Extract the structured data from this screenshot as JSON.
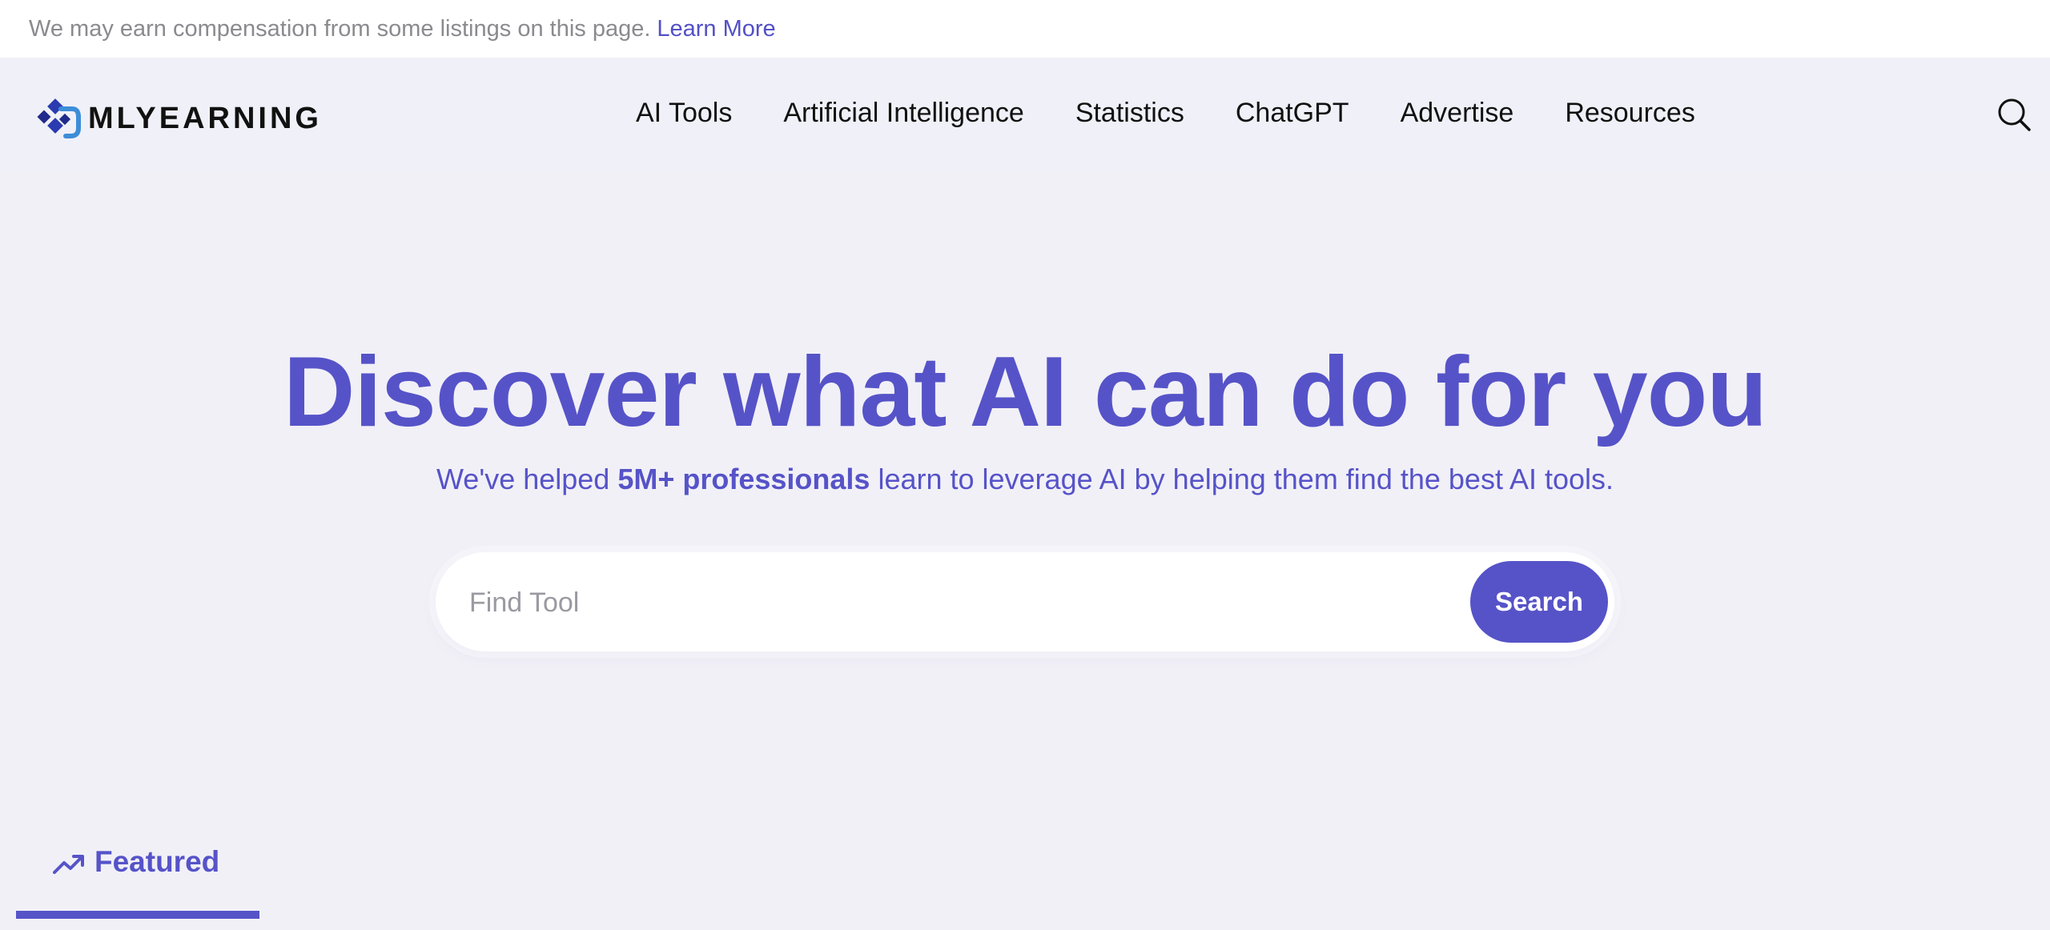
{
  "disclosure": {
    "text": "We may earn compensation from some listings on this page.",
    "link": "Learn More"
  },
  "header": {
    "logo_text": "MLYEARNING",
    "nav": [
      {
        "label": "AI Tools"
      },
      {
        "label": "Artificial Intelligence"
      },
      {
        "label": "Statistics"
      },
      {
        "label": "ChatGPT"
      },
      {
        "label": "Advertise"
      },
      {
        "label": "Resources"
      }
    ],
    "search_icon": "search-icon"
  },
  "hero": {
    "title": "Discover what AI can do for you",
    "subtitle_prefix": "We've helped ",
    "subtitle_bold": "5M+ professionals",
    "subtitle_suffix": " learn to leverage AI by helping them find the best AI tools."
  },
  "search": {
    "placeholder": "Find Tool",
    "value": "",
    "button_label": "Search"
  },
  "tabs": {
    "featured_label": "Featured",
    "featured_icon": "trending-up-icon"
  },
  "colors": {
    "accent": "#5653c8",
    "background": "#f1f0f7",
    "link": "#5350c6"
  }
}
